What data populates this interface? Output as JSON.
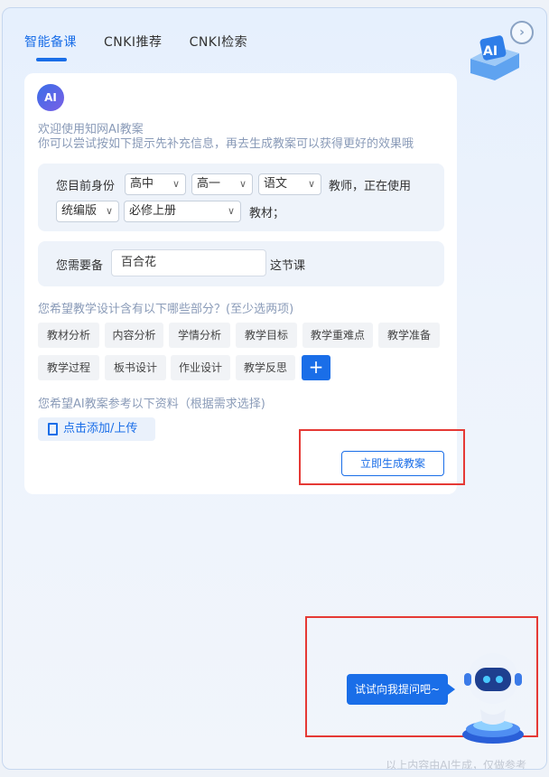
{
  "tabs": [
    {
      "label": "智能备课",
      "active": true
    },
    {
      "label": "CNKI推荐",
      "active": false
    },
    {
      "label": "CNKI检索",
      "active": false
    }
  ],
  "header": {
    "collapse_icon": "chevron-right-icon"
  },
  "card": {
    "badge": "AI",
    "welcome_line1": "欢迎使用知网AI教案",
    "welcome_line2": "你可以尝试按如下提示先补充信息，再去生成教案可以获得更好的效果哦",
    "identity": {
      "prefix": "您目前身份",
      "stage": "高中",
      "grade": "高一",
      "subject": "语文",
      "middle": "教师，正在使用",
      "edition": "统编版",
      "volume": "必修上册",
      "suffix": "教材；"
    },
    "lesson": {
      "prefix": "您需要备",
      "value": "百合花",
      "suffix": "这节课"
    },
    "parts_label": "您希望教学设计含有以下哪些部分？(至少选两项)",
    "parts": [
      "教材分析",
      "内容分析",
      "学情分析",
      "教学目标",
      "教学重难点",
      "教学准备",
      "教学过程",
      "板书设计",
      "作业设计",
      "教学反思"
    ],
    "add_symbol": "+",
    "reference_label": "您希望AI教案参考以下资料（根据需求选择)",
    "upload_label": "点击添加/上传",
    "generate_label": "立即生成教案"
  },
  "assistant": {
    "bubble": "试试向我提问吧~",
    "robot_icon": "robot-assistant-icon"
  },
  "footer": "以上内容由AI生成，仅做参考",
  "colors": {
    "accent": "#1a6ee8",
    "highlight": "#e53935"
  }
}
